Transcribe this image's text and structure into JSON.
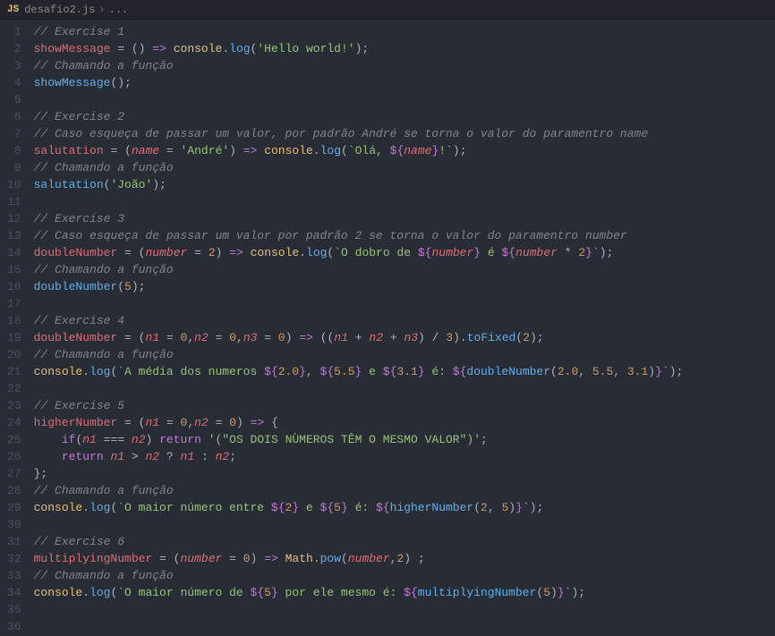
{
  "breadcrumb": {
    "icon_label": "JS",
    "filename": "desafio2.js",
    "separator": "›",
    "rest": "..."
  },
  "gutter": {
    "start": 1,
    "end": 36
  },
  "code": {
    "lines": [
      [
        [
          "c-comment",
          "// Exercise 1"
        ]
      ],
      [
        [
          "c-var",
          "showMessage"
        ],
        [
          "c-white",
          " "
        ],
        [
          "c-op",
          "="
        ],
        [
          "c-white",
          " "
        ],
        [
          "c-punct",
          "()"
        ],
        [
          "c-white",
          " "
        ],
        [
          "c-kw",
          "=>"
        ],
        [
          "c-white",
          " "
        ],
        [
          "c-obj",
          "console"
        ],
        [
          "c-punct",
          "."
        ],
        [
          "c-fn",
          "log"
        ],
        [
          "c-punct",
          "("
        ],
        [
          "c-str",
          "'Hello world!'"
        ],
        [
          "c-punct",
          ");"
        ]
      ],
      [
        [
          "c-comment",
          "// Chamando a função"
        ]
      ],
      [
        [
          "c-fn",
          "showMessage"
        ],
        [
          "c-punct",
          "();"
        ]
      ],
      [],
      [
        [
          "c-comment",
          "// Exercise 2"
        ]
      ],
      [
        [
          "c-comment",
          "// Caso esqueça de passar um valor, por padrão André se torna o valor do paramentro name"
        ]
      ],
      [
        [
          "c-var",
          "salutation"
        ],
        [
          "c-white",
          " "
        ],
        [
          "c-op",
          "="
        ],
        [
          "c-white",
          " "
        ],
        [
          "c-punct",
          "("
        ],
        [
          "c-param",
          "name"
        ],
        [
          "c-white",
          " "
        ],
        [
          "c-op",
          "="
        ],
        [
          "c-white",
          " "
        ],
        [
          "c-str",
          "'André'"
        ],
        [
          "c-punct",
          ")"
        ],
        [
          "c-white",
          " "
        ],
        [
          "c-kw",
          "=>"
        ],
        [
          "c-white",
          " "
        ],
        [
          "c-obj",
          "console"
        ],
        [
          "c-punct",
          "."
        ],
        [
          "c-fn",
          "log"
        ],
        [
          "c-punct",
          "("
        ],
        [
          "c-str",
          "`Olá, "
        ],
        [
          "c-kw",
          "${"
        ],
        [
          "c-param",
          "name"
        ],
        [
          "c-kw",
          "}"
        ],
        [
          "c-str",
          "!`"
        ],
        [
          "c-punct",
          ");"
        ]
      ],
      [
        [
          "c-comment",
          "// Chamando a função"
        ]
      ],
      [
        [
          "c-fn",
          "salutation"
        ],
        [
          "c-punct",
          "("
        ],
        [
          "c-str",
          "'João'"
        ],
        [
          "c-punct",
          ");"
        ]
      ],
      [],
      [
        [
          "c-comment",
          "// Exercise 3"
        ]
      ],
      [
        [
          "c-comment",
          "// Caso esqueça de passar um valor por padrão 2 se torna o valor do paramentro number"
        ]
      ],
      [
        [
          "c-var",
          "doubleNumber"
        ],
        [
          "c-white",
          " "
        ],
        [
          "c-op",
          "="
        ],
        [
          "c-white",
          " "
        ],
        [
          "c-punct",
          "("
        ],
        [
          "c-param",
          "number"
        ],
        [
          "c-white",
          " "
        ],
        [
          "c-op",
          "="
        ],
        [
          "c-white",
          " "
        ],
        [
          "c-num",
          "2"
        ],
        [
          "c-punct",
          ")"
        ],
        [
          "c-white",
          " "
        ],
        [
          "c-kw",
          "=>"
        ],
        [
          "c-white",
          " "
        ],
        [
          "c-obj",
          "console"
        ],
        [
          "c-punct",
          "."
        ],
        [
          "c-fn",
          "log"
        ],
        [
          "c-punct",
          "("
        ],
        [
          "c-str",
          "`O dobro de "
        ],
        [
          "c-kw",
          "${"
        ],
        [
          "c-param",
          "number"
        ],
        [
          "c-kw",
          "}"
        ],
        [
          "c-str",
          " é "
        ],
        [
          "c-kw",
          "${"
        ],
        [
          "c-param",
          "number"
        ],
        [
          "c-white",
          " "
        ],
        [
          "c-op",
          "*"
        ],
        [
          "c-white",
          " "
        ],
        [
          "c-num",
          "2"
        ],
        [
          "c-kw",
          "}"
        ],
        [
          "c-str",
          "`"
        ],
        [
          "c-punct",
          ");"
        ]
      ],
      [
        [
          "c-comment",
          "// Chamando a função"
        ]
      ],
      [
        [
          "c-fn",
          "doubleNumber"
        ],
        [
          "c-punct",
          "("
        ],
        [
          "c-num",
          "5"
        ],
        [
          "c-punct",
          ");"
        ]
      ],
      [],
      [
        [
          "c-comment",
          "// Exercise 4"
        ]
      ],
      [
        [
          "c-var",
          "doubleNumber"
        ],
        [
          "c-white",
          " "
        ],
        [
          "c-op",
          "="
        ],
        [
          "c-white",
          " "
        ],
        [
          "c-punct",
          "("
        ],
        [
          "c-param",
          "n1"
        ],
        [
          "c-white",
          " "
        ],
        [
          "c-op",
          "="
        ],
        [
          "c-white",
          " "
        ],
        [
          "c-num",
          "0"
        ],
        [
          "c-punct",
          ","
        ],
        [
          "c-param",
          "n2"
        ],
        [
          "c-white",
          " "
        ],
        [
          "c-op",
          "="
        ],
        [
          "c-white",
          " "
        ],
        [
          "c-num",
          "0"
        ],
        [
          "c-punct",
          ","
        ],
        [
          "c-param",
          "n3"
        ],
        [
          "c-white",
          " "
        ],
        [
          "c-op",
          "="
        ],
        [
          "c-white",
          " "
        ],
        [
          "c-num",
          "0"
        ],
        [
          "c-punct",
          ")"
        ],
        [
          "c-white",
          " "
        ],
        [
          "c-kw",
          "=>"
        ],
        [
          "c-white",
          " "
        ],
        [
          "c-punct",
          "(("
        ],
        [
          "c-param",
          "n1"
        ],
        [
          "c-white",
          " "
        ],
        [
          "c-op",
          "+"
        ],
        [
          "c-white",
          " "
        ],
        [
          "c-param",
          "n2"
        ],
        [
          "c-white",
          " "
        ],
        [
          "c-op",
          "+"
        ],
        [
          "c-white",
          " "
        ],
        [
          "c-param",
          "n3"
        ],
        [
          "c-punct",
          ")"
        ],
        [
          "c-white",
          " "
        ],
        [
          "c-op",
          "/"
        ],
        [
          "c-white",
          " "
        ],
        [
          "c-num",
          "3"
        ],
        [
          "c-punct",
          ")."
        ],
        [
          "c-fn",
          "toFixed"
        ],
        [
          "c-punct",
          "("
        ],
        [
          "c-num",
          "2"
        ],
        [
          "c-punct",
          ");"
        ]
      ],
      [
        [
          "c-comment",
          "// Chamando a função"
        ]
      ],
      [
        [
          "c-obj",
          "console"
        ],
        [
          "c-punct",
          "."
        ],
        [
          "c-fn",
          "log"
        ],
        [
          "c-punct",
          "("
        ],
        [
          "c-str",
          "`A média dos numeros "
        ],
        [
          "c-kw",
          "${"
        ],
        [
          "c-num",
          "2.0"
        ],
        [
          "c-kw",
          "}"
        ],
        [
          "c-str",
          ", "
        ],
        [
          "c-kw",
          "${"
        ],
        [
          "c-num",
          "5.5"
        ],
        [
          "c-kw",
          "}"
        ],
        [
          "c-str",
          " e "
        ],
        [
          "c-kw",
          "${"
        ],
        [
          "c-num",
          "3.1"
        ],
        [
          "c-kw",
          "}"
        ],
        [
          "c-str",
          " é: "
        ],
        [
          "c-kw",
          "${"
        ],
        [
          "c-fn",
          "doubleNumber"
        ],
        [
          "c-punct",
          "("
        ],
        [
          "c-num",
          "2.0"
        ],
        [
          "c-punct",
          ", "
        ],
        [
          "c-num",
          "5.5"
        ],
        [
          "c-punct",
          ", "
        ],
        [
          "c-num",
          "3.1"
        ],
        [
          "c-punct",
          ")"
        ],
        [
          "c-kw",
          "}"
        ],
        [
          "c-str",
          "`"
        ],
        [
          "c-punct",
          ");"
        ]
      ],
      [],
      [
        [
          "c-comment",
          "// Exercise 5"
        ]
      ],
      [
        [
          "c-var",
          "higherNumber"
        ],
        [
          "c-white",
          " "
        ],
        [
          "c-op",
          "="
        ],
        [
          "c-white",
          " "
        ],
        [
          "c-punct",
          "("
        ],
        [
          "c-param",
          "n1"
        ],
        [
          "c-white",
          " "
        ],
        [
          "c-op",
          "="
        ],
        [
          "c-white",
          " "
        ],
        [
          "c-num",
          "0"
        ],
        [
          "c-punct",
          ","
        ],
        [
          "c-param",
          "n2"
        ],
        [
          "c-white",
          " "
        ],
        [
          "c-op",
          "="
        ],
        [
          "c-white",
          " "
        ],
        [
          "c-num",
          "0"
        ],
        [
          "c-punct",
          ")"
        ],
        [
          "c-white",
          " "
        ],
        [
          "c-kw",
          "=>"
        ],
        [
          "c-white",
          " "
        ],
        [
          "c-punct",
          "{"
        ]
      ],
      [
        [
          "c-white",
          "    "
        ],
        [
          "c-kw",
          "if"
        ],
        [
          "c-punct",
          "("
        ],
        [
          "c-param",
          "n1"
        ],
        [
          "c-white",
          " "
        ],
        [
          "c-op",
          "==="
        ],
        [
          "c-white",
          " "
        ],
        [
          "c-param",
          "n2"
        ],
        [
          "c-punct",
          ")"
        ],
        [
          "c-white",
          " "
        ],
        [
          "c-kw",
          "return"
        ],
        [
          "c-white",
          " "
        ],
        [
          "c-str",
          "'(\"OS DOIS NÙMEROS TÊM O MESMO VALOR\")'"
        ],
        [
          "c-punct",
          ";"
        ]
      ],
      [
        [
          "c-white",
          "    "
        ],
        [
          "c-kw",
          "return"
        ],
        [
          "c-white",
          " "
        ],
        [
          "c-param",
          "n1"
        ],
        [
          "c-white",
          " "
        ],
        [
          "c-op",
          ">"
        ],
        [
          "c-white",
          " "
        ],
        [
          "c-param",
          "n2"
        ],
        [
          "c-white",
          " "
        ],
        [
          "c-op",
          "?"
        ],
        [
          "c-white",
          " "
        ],
        [
          "c-param",
          "n1"
        ],
        [
          "c-white",
          " "
        ],
        [
          "c-op",
          ":"
        ],
        [
          "c-white",
          " "
        ],
        [
          "c-param",
          "n2"
        ],
        [
          "c-punct",
          ";"
        ]
      ],
      [
        [
          "c-punct",
          "};"
        ]
      ],
      [
        [
          "c-comment",
          "// Chamando a função"
        ]
      ],
      [
        [
          "c-obj",
          "console"
        ],
        [
          "c-punct",
          "."
        ],
        [
          "c-fn",
          "log"
        ],
        [
          "c-punct",
          "("
        ],
        [
          "c-str",
          "`O maior número entre "
        ],
        [
          "c-kw",
          "${"
        ],
        [
          "c-num",
          "2"
        ],
        [
          "c-kw",
          "}"
        ],
        [
          "c-str",
          " e "
        ],
        [
          "c-kw",
          "${"
        ],
        [
          "c-num",
          "5"
        ],
        [
          "c-kw",
          "}"
        ],
        [
          "c-str",
          " é: "
        ],
        [
          "c-kw",
          "${"
        ],
        [
          "c-fn",
          "higherNumber"
        ],
        [
          "c-punct",
          "("
        ],
        [
          "c-num",
          "2"
        ],
        [
          "c-punct",
          ", "
        ],
        [
          "c-num",
          "5"
        ],
        [
          "c-punct",
          ")"
        ],
        [
          "c-kw",
          "}"
        ],
        [
          "c-str",
          "`"
        ],
        [
          "c-punct",
          ");"
        ]
      ],
      [],
      [
        [
          "c-comment",
          "// Exercise 6"
        ]
      ],
      [
        [
          "c-var",
          "multiplyingNumber"
        ],
        [
          "c-white",
          " "
        ],
        [
          "c-op",
          "="
        ],
        [
          "c-white",
          " "
        ],
        [
          "c-punct",
          "("
        ],
        [
          "c-param",
          "number"
        ],
        [
          "c-white",
          " "
        ],
        [
          "c-op",
          "="
        ],
        [
          "c-white",
          " "
        ],
        [
          "c-num",
          "0"
        ],
        [
          "c-punct",
          ")"
        ],
        [
          "c-white",
          " "
        ],
        [
          "c-kw",
          "=>"
        ],
        [
          "c-white",
          " "
        ],
        [
          "c-obj",
          "Math"
        ],
        [
          "c-punct",
          "."
        ],
        [
          "c-fn",
          "pow"
        ],
        [
          "c-punct",
          "("
        ],
        [
          "c-param",
          "number"
        ],
        [
          "c-punct",
          ","
        ],
        [
          "c-num",
          "2"
        ],
        [
          "c-punct",
          ")"
        ],
        [
          "c-white",
          " "
        ],
        [
          "c-punct",
          ";"
        ]
      ],
      [
        [
          "c-comment",
          "// Chamando a função"
        ]
      ],
      [
        [
          "c-obj",
          "console"
        ],
        [
          "c-punct",
          "."
        ],
        [
          "c-fn",
          "log"
        ],
        [
          "c-punct",
          "("
        ],
        [
          "c-str",
          "`O maior número de "
        ],
        [
          "c-kw",
          "${"
        ],
        [
          "c-num",
          "5"
        ],
        [
          "c-kw",
          "}"
        ],
        [
          "c-str",
          " por ele mesmo é: "
        ],
        [
          "c-kw",
          "${"
        ],
        [
          "c-fn",
          "multiplyingNumber"
        ],
        [
          "c-punct",
          "("
        ],
        [
          "c-num",
          "5"
        ],
        [
          "c-punct",
          ")"
        ],
        [
          "c-kw",
          "}"
        ],
        [
          "c-str",
          "`"
        ],
        [
          "c-punct",
          ");"
        ]
      ],
      [],
      []
    ]
  }
}
